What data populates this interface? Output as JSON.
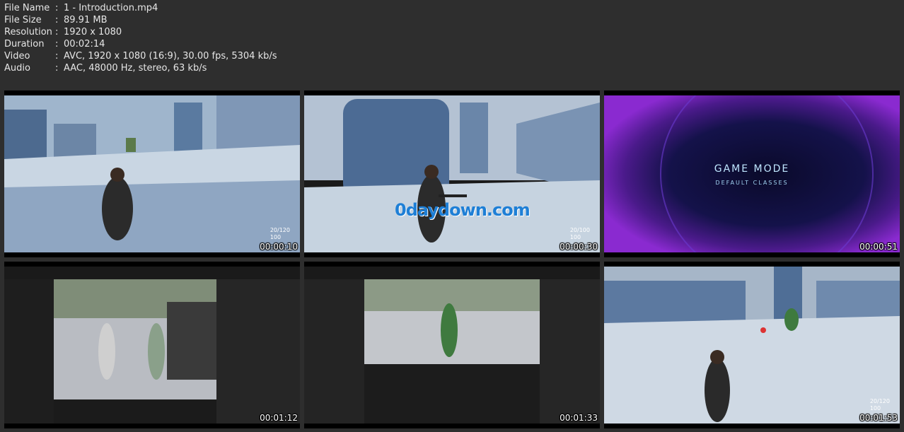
{
  "info": [
    {
      "label": "File Name",
      "sep": ":",
      "value": "1 - Introduction.mp4"
    },
    {
      "label": "File Size",
      "sep": ":",
      "value": "89.91 MB"
    },
    {
      "label": "Resolution",
      "sep": ":",
      "value": "1920 x 1080"
    },
    {
      "label": "Duration",
      "sep": ":",
      "value": "00:02:14"
    },
    {
      "label": "Video",
      "sep": ":",
      "value": "AVC, 1920 x 1080 (16:9), 30.00 fps, 5304 kb/s"
    },
    {
      "label": "Audio",
      "sep": ":",
      "value": "AAC, 48000 Hz, stereo, 63 kb/s"
    }
  ],
  "thumbnails": [
    {
      "timestamp": "00:00:10",
      "hud_ammo": "20/120",
      "hud_health": "100"
    },
    {
      "timestamp": "00:00:30",
      "hud_ammo": "20/100",
      "hud_health": "100",
      "watermark": "0daydown.com"
    },
    {
      "timestamp": "00:00:51",
      "title": "GAME MODE",
      "subtitle": "DEFAULT CLASSES"
    },
    {
      "timestamp": "00:01:12"
    },
    {
      "timestamp": "00:01:33"
    },
    {
      "timestamp": "00:01:53",
      "hud_ammo": "20/120",
      "hud_health": "100"
    }
  ]
}
